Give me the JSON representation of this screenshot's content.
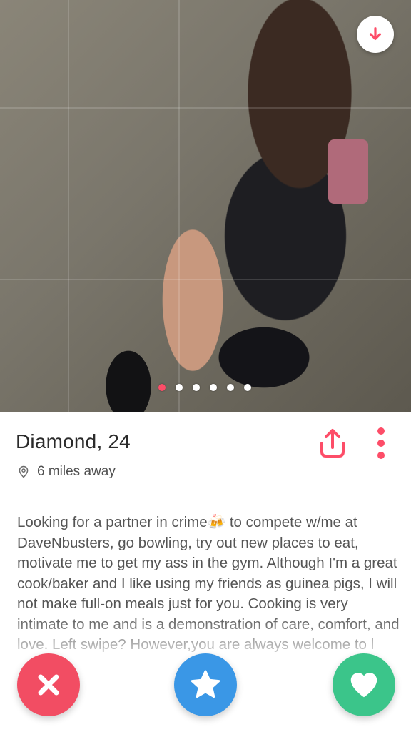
{
  "profile": {
    "name_age": "Diamond, 24",
    "distance": "6 miles away"
  },
  "bio": {
    "text": "Looking for a partner in crime🍻 to compete w/me at DaveNbusters, go bowling, try out new places to eat, motivate me to get my ass in the gym. Although I'm a great cook/baker and I like using my friends as guinea pigs, I will not make full-on meals just for you. Cooking is very intimate to me and is a demonstration of care, comfort, and love. Left swipe? However,you are always welcome to l"
  },
  "photo": {
    "count": 6,
    "active_index": 0
  },
  "colors": {
    "accent": "#fd4d68",
    "nope": "#f24d63",
    "super_like": "#3a97e6",
    "like": "#3bc58a"
  },
  "icons": {
    "down": "arrow-down-icon",
    "share": "share-icon",
    "more": "more-vertical-icon",
    "location": "location-pin-icon",
    "nope": "close-icon",
    "super_like": "star-icon",
    "like": "heart-icon"
  }
}
